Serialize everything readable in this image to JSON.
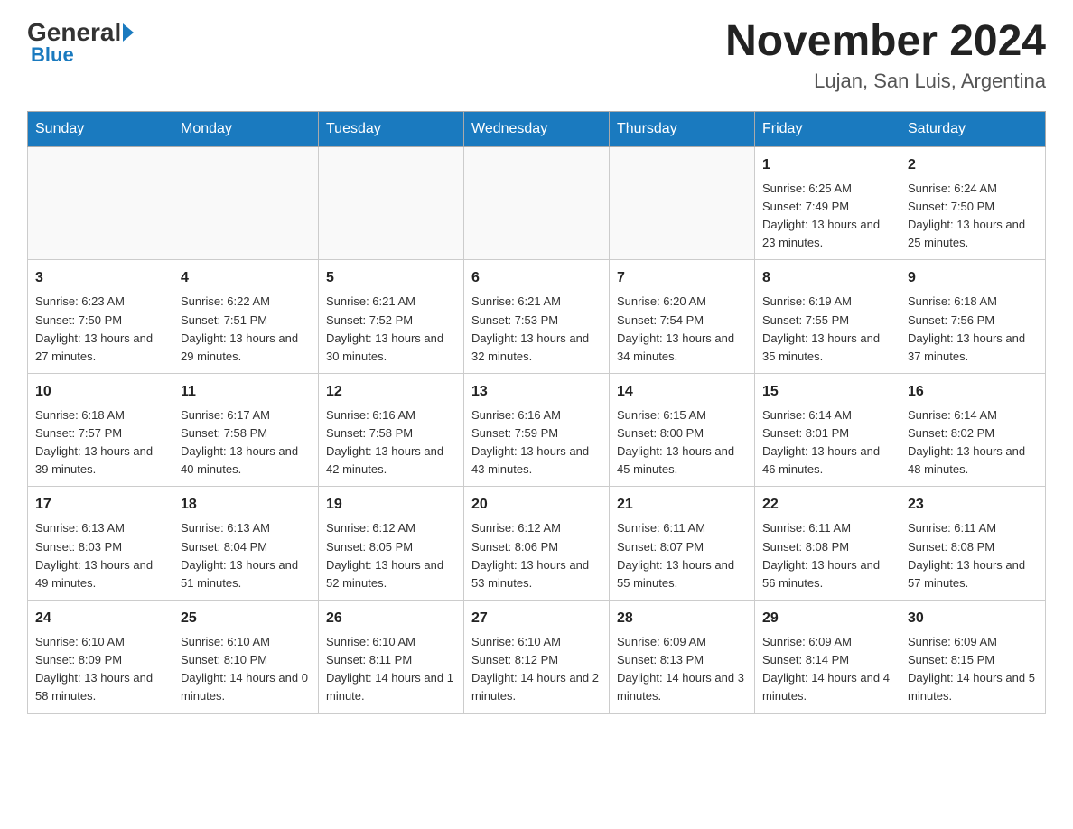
{
  "header": {
    "logo_general": "General",
    "logo_blue": "Blue",
    "month_title": "November 2024",
    "location": "Lujan, San Luis, Argentina"
  },
  "days_of_week": [
    "Sunday",
    "Monday",
    "Tuesday",
    "Wednesday",
    "Thursday",
    "Friday",
    "Saturday"
  ],
  "weeks": [
    [
      {
        "day": "",
        "info": ""
      },
      {
        "day": "",
        "info": ""
      },
      {
        "day": "",
        "info": ""
      },
      {
        "day": "",
        "info": ""
      },
      {
        "day": "",
        "info": ""
      },
      {
        "day": "1",
        "info": "Sunrise: 6:25 AM\nSunset: 7:49 PM\nDaylight: 13 hours and 23 minutes."
      },
      {
        "day": "2",
        "info": "Sunrise: 6:24 AM\nSunset: 7:50 PM\nDaylight: 13 hours and 25 minutes."
      }
    ],
    [
      {
        "day": "3",
        "info": "Sunrise: 6:23 AM\nSunset: 7:50 PM\nDaylight: 13 hours and 27 minutes."
      },
      {
        "day": "4",
        "info": "Sunrise: 6:22 AM\nSunset: 7:51 PM\nDaylight: 13 hours and 29 minutes."
      },
      {
        "day": "5",
        "info": "Sunrise: 6:21 AM\nSunset: 7:52 PM\nDaylight: 13 hours and 30 minutes."
      },
      {
        "day": "6",
        "info": "Sunrise: 6:21 AM\nSunset: 7:53 PM\nDaylight: 13 hours and 32 minutes."
      },
      {
        "day": "7",
        "info": "Sunrise: 6:20 AM\nSunset: 7:54 PM\nDaylight: 13 hours and 34 minutes."
      },
      {
        "day": "8",
        "info": "Sunrise: 6:19 AM\nSunset: 7:55 PM\nDaylight: 13 hours and 35 minutes."
      },
      {
        "day": "9",
        "info": "Sunrise: 6:18 AM\nSunset: 7:56 PM\nDaylight: 13 hours and 37 minutes."
      }
    ],
    [
      {
        "day": "10",
        "info": "Sunrise: 6:18 AM\nSunset: 7:57 PM\nDaylight: 13 hours and 39 minutes."
      },
      {
        "day": "11",
        "info": "Sunrise: 6:17 AM\nSunset: 7:58 PM\nDaylight: 13 hours and 40 minutes."
      },
      {
        "day": "12",
        "info": "Sunrise: 6:16 AM\nSunset: 7:58 PM\nDaylight: 13 hours and 42 minutes."
      },
      {
        "day": "13",
        "info": "Sunrise: 6:16 AM\nSunset: 7:59 PM\nDaylight: 13 hours and 43 minutes."
      },
      {
        "day": "14",
        "info": "Sunrise: 6:15 AM\nSunset: 8:00 PM\nDaylight: 13 hours and 45 minutes."
      },
      {
        "day": "15",
        "info": "Sunrise: 6:14 AM\nSunset: 8:01 PM\nDaylight: 13 hours and 46 minutes."
      },
      {
        "day": "16",
        "info": "Sunrise: 6:14 AM\nSunset: 8:02 PM\nDaylight: 13 hours and 48 minutes."
      }
    ],
    [
      {
        "day": "17",
        "info": "Sunrise: 6:13 AM\nSunset: 8:03 PM\nDaylight: 13 hours and 49 minutes."
      },
      {
        "day": "18",
        "info": "Sunrise: 6:13 AM\nSunset: 8:04 PM\nDaylight: 13 hours and 51 minutes."
      },
      {
        "day": "19",
        "info": "Sunrise: 6:12 AM\nSunset: 8:05 PM\nDaylight: 13 hours and 52 minutes."
      },
      {
        "day": "20",
        "info": "Sunrise: 6:12 AM\nSunset: 8:06 PM\nDaylight: 13 hours and 53 minutes."
      },
      {
        "day": "21",
        "info": "Sunrise: 6:11 AM\nSunset: 8:07 PM\nDaylight: 13 hours and 55 minutes."
      },
      {
        "day": "22",
        "info": "Sunrise: 6:11 AM\nSunset: 8:08 PM\nDaylight: 13 hours and 56 minutes."
      },
      {
        "day": "23",
        "info": "Sunrise: 6:11 AM\nSunset: 8:08 PM\nDaylight: 13 hours and 57 minutes."
      }
    ],
    [
      {
        "day": "24",
        "info": "Sunrise: 6:10 AM\nSunset: 8:09 PM\nDaylight: 13 hours and 58 minutes."
      },
      {
        "day": "25",
        "info": "Sunrise: 6:10 AM\nSunset: 8:10 PM\nDaylight: 14 hours and 0 minutes."
      },
      {
        "day": "26",
        "info": "Sunrise: 6:10 AM\nSunset: 8:11 PM\nDaylight: 14 hours and 1 minute."
      },
      {
        "day": "27",
        "info": "Sunrise: 6:10 AM\nSunset: 8:12 PM\nDaylight: 14 hours and 2 minutes."
      },
      {
        "day": "28",
        "info": "Sunrise: 6:09 AM\nSunset: 8:13 PM\nDaylight: 14 hours and 3 minutes."
      },
      {
        "day": "29",
        "info": "Sunrise: 6:09 AM\nSunset: 8:14 PM\nDaylight: 14 hours and 4 minutes."
      },
      {
        "day": "30",
        "info": "Sunrise: 6:09 AM\nSunset: 8:15 PM\nDaylight: 14 hours and 5 minutes."
      }
    ]
  ]
}
